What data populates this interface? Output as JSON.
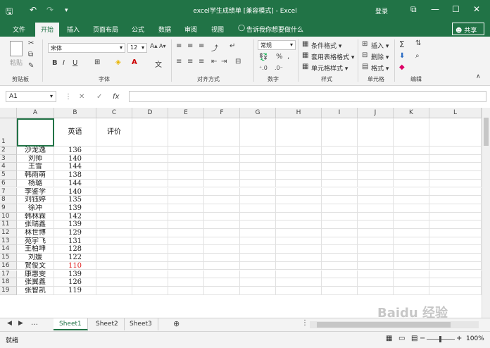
{
  "titlebar": {
    "title": "excel学生成绩单  [兼容模式]  -  Excel",
    "login": "登录",
    "undo_glyph": "↶",
    "redo_glyph": "↷",
    "save_glyph": "🖫",
    "more_glyph": "▾",
    "min_glyph": "—",
    "max_glyph": "☐",
    "close_glyph": "✕",
    "restore_glyph": "⧉"
  },
  "tabs": [
    "文件",
    "开始",
    "插入",
    "页面布局",
    "公式",
    "数据",
    "审阅",
    "视图"
  ],
  "tell_me": "告诉我你想要做什么",
  "share": "共享",
  "ribbon": {
    "paste": "粘贴",
    "font_name": "宋体",
    "font_size": "12",
    "number_format": "常规",
    "groups": {
      "clipboard": "剪贴板",
      "font": "字体",
      "alignment": "对齐方式",
      "number": "数字",
      "styles": "样式",
      "cells": "单元格",
      "editing": "编辑"
    },
    "styles_items": [
      "条件格式 ▾",
      "套用表格格式 ▾",
      "单元格样式 ▾"
    ],
    "cells_items": [
      "插入 ▾",
      "删除 ▾",
      "格式 ▾"
    ],
    "font_buttons": [
      "B",
      "I",
      "U"
    ]
  },
  "namebox": "A1",
  "fx": "fx",
  "columns": [
    "A",
    "B",
    "C",
    "D",
    "E",
    "F",
    "G",
    "H",
    "I",
    "J",
    "K",
    "L"
  ],
  "headers": {
    "b": "英语",
    "c": "评价"
  },
  "rows": [
    {
      "n": "1",
      "name": "",
      "score": ""
    },
    {
      "n": "2",
      "name": "沙龙逸",
      "score": "136"
    },
    {
      "n": "3",
      "name": "刘帅",
      "score": "140"
    },
    {
      "n": "4",
      "name": "王雪",
      "score": "144"
    },
    {
      "n": "5",
      "name": "韩雨萌",
      "score": "138"
    },
    {
      "n": "6",
      "name": "杨璐",
      "score": "144"
    },
    {
      "n": "7",
      "name": "李鉴学",
      "score": "140"
    },
    {
      "n": "8",
      "name": "刘钰婷",
      "score": "135"
    },
    {
      "n": "9",
      "name": "徐冲",
      "score": "139"
    },
    {
      "n": "10",
      "name": "韩林霖",
      "score": "142"
    },
    {
      "n": "11",
      "name": "张瑞鑫",
      "score": "139"
    },
    {
      "n": "12",
      "name": "林世博",
      "score": "129"
    },
    {
      "n": "13",
      "name": "苑宇飞",
      "score": "131"
    },
    {
      "n": "14",
      "name": "王柏坤",
      "score": "128"
    },
    {
      "n": "15",
      "name": "刘媛",
      "score": "122"
    },
    {
      "n": "16",
      "name": "贺俊文",
      "score": "110",
      "red": true
    },
    {
      "n": "17",
      "name": "康惠雯",
      "score": "139"
    },
    {
      "n": "18",
      "name": "张翼鑫",
      "score": "126"
    },
    {
      "n": "19",
      "name": "张智凯",
      "score": "119"
    }
  ],
  "sheets": [
    "Sheet1",
    "Sheet2",
    "Sheet3"
  ],
  "status": {
    "ready": "就绪",
    "zoom": "100%"
  },
  "watermark": "Baidu 经验"
}
